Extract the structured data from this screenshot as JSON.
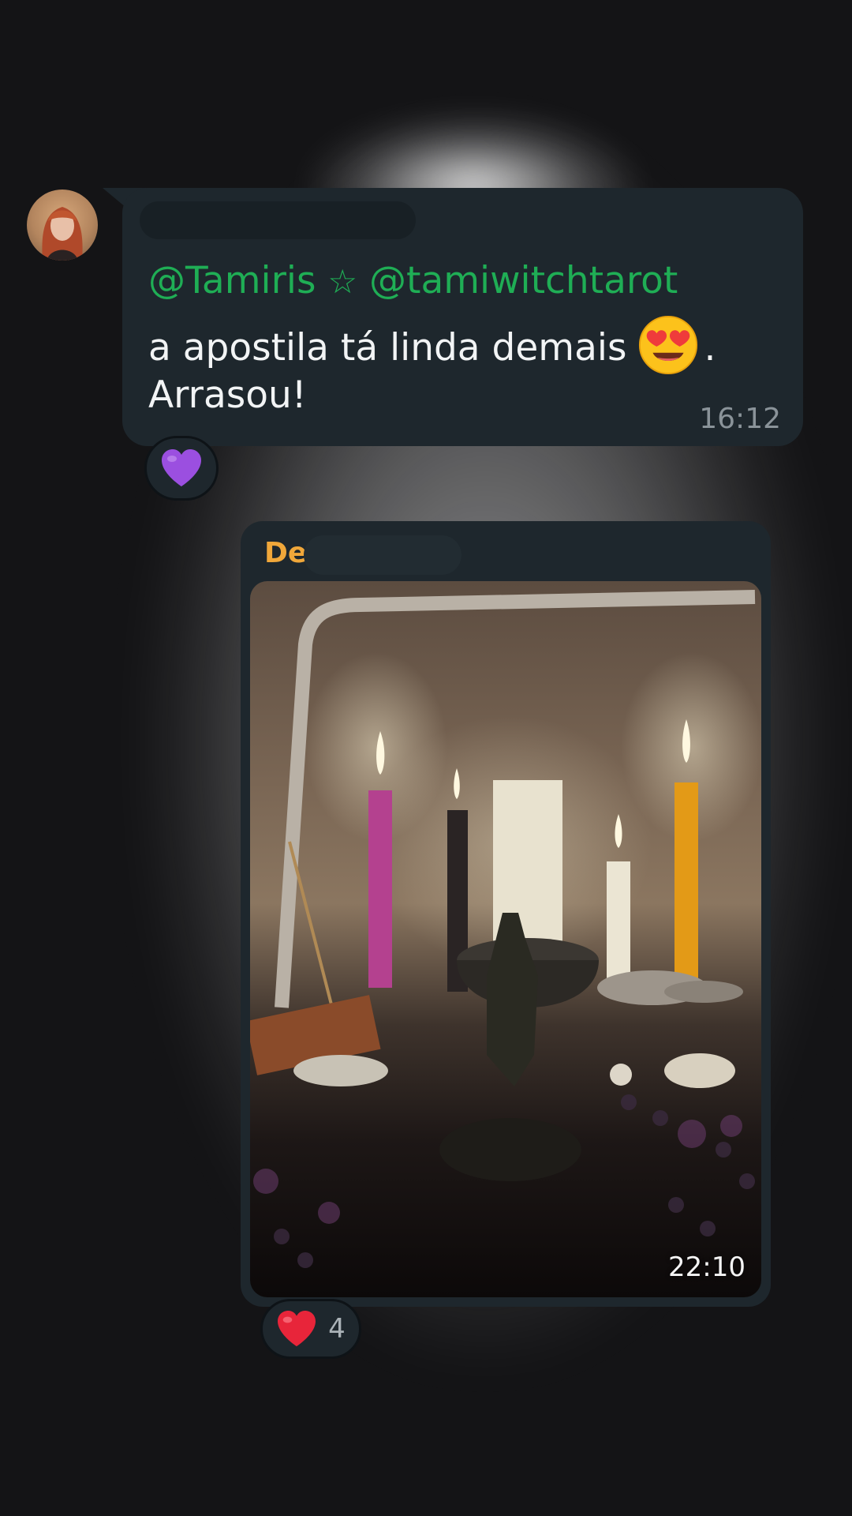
{
  "messages": [
    {
      "mention_1": "@Tamiris",
      "mention_star": "☆",
      "mention_2": "@tamiwitchtarot",
      "text_line1": "a apostila tá linda demais",
      "text_line1_suffix": ".",
      "text_line2": "Arrasou!",
      "emoji_inline": "heart-eyes-emoji",
      "time": "16:12",
      "reaction_emoji": "purple-heart-emoji"
    },
    {
      "sender_visible": "De",
      "time": "22:10",
      "reaction_emoji": "red-heart-emoji",
      "reaction_count": "4"
    }
  ],
  "colors": {
    "background": "#141416",
    "bubble": "#1e272d",
    "mention": "#1fae55",
    "sender_name": "#f0a73a",
    "timestamp": "#8a9399"
  }
}
